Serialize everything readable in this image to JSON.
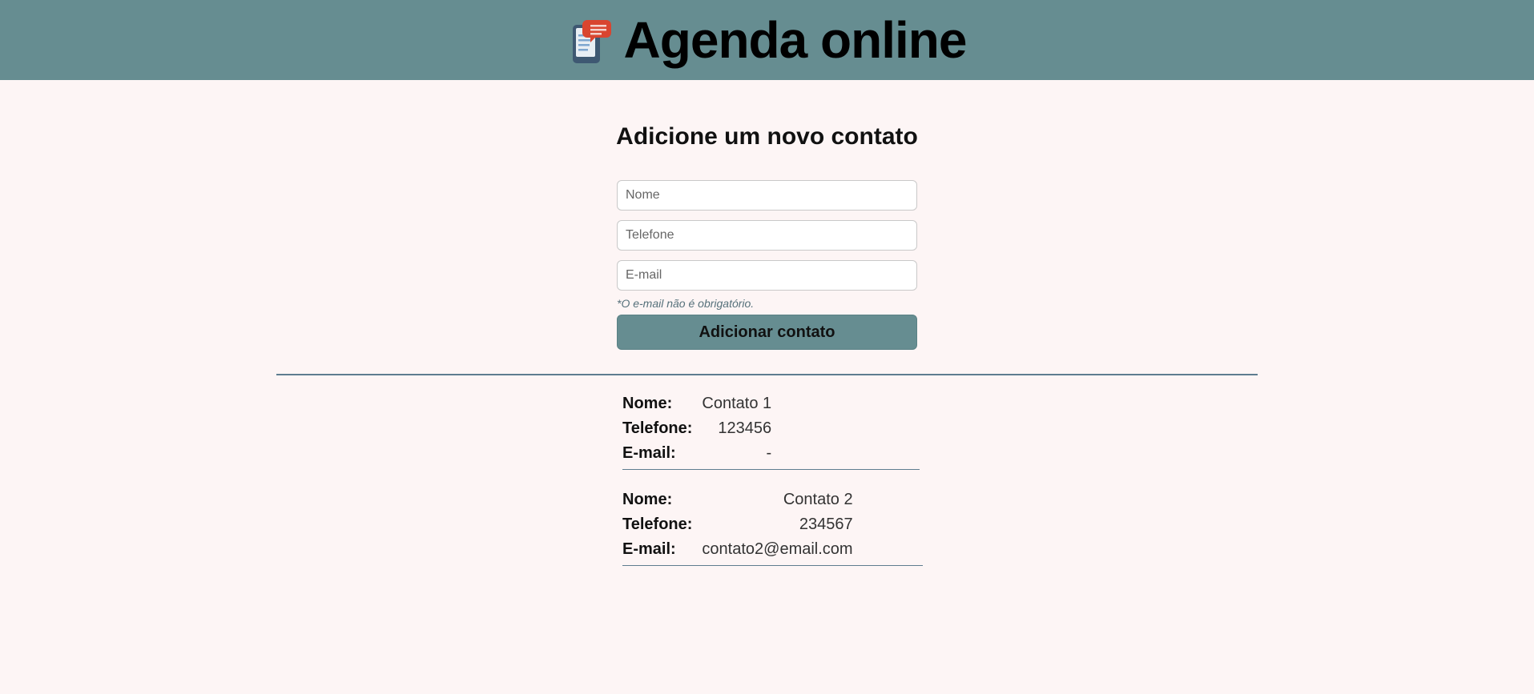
{
  "header": {
    "title": "Agenda online",
    "logo_icon": "notebook-icon"
  },
  "form": {
    "title": "Adicione um novo contato",
    "name_placeholder": "Nome",
    "phone_placeholder": "Telefone",
    "email_placeholder": "E-mail",
    "email_note": "*O e-mail não é obrigatório.",
    "submit_label": "Adicionar contato"
  },
  "contacts": [
    {
      "name_label": "Nome:",
      "name": "Contato 1",
      "phone_label": "Telefone:",
      "phone": "123456",
      "email_label": "E-mail:",
      "email": "-"
    },
    {
      "name_label": "Nome:",
      "name": "Contato 2",
      "phone_label": "Telefone:",
      "phone": "234567",
      "email_label": "E-mail:",
      "email": "contato2@email.com"
    }
  ],
  "colors": {
    "header_bg": "#668d91",
    "page_bg": "#fdf5f5",
    "divider": "#5e7c8f"
  }
}
